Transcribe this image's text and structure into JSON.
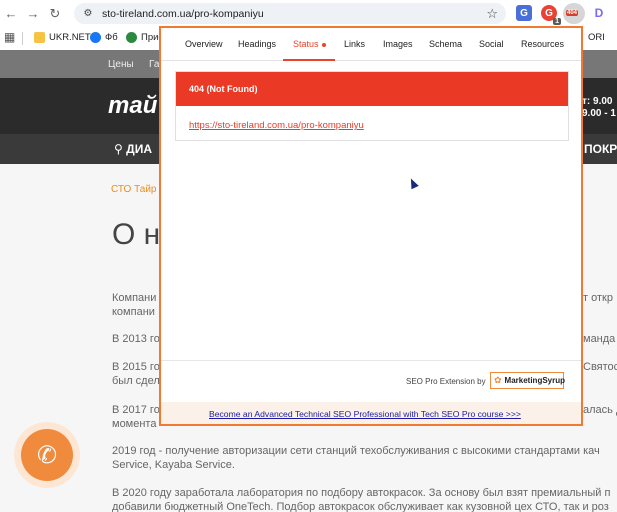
{
  "browser": {
    "url": "sto-tireland.com.ua/pro-kompaniyu",
    "star_icon": "star-icon",
    "extensions": {
      "ext_a_label": "G",
      "ext_b_badge": "1",
      "ext_c_badge": "404",
      "ext_d_label": "D"
    }
  },
  "bookmarks": {
    "items": [
      "UKR.NET",
      "Фб",
      "Прие",
      "ORI"
    ]
  },
  "website": {
    "nav": [
      "Цены",
      "Га"
    ],
    "logo": "тай",
    "hours_line1": "т: 9.00",
    "hours_line2": "9.00 - 1",
    "menu_left": "ДИА",
    "menu_right": "ПОКР",
    "breadcrumb": "СТО Тайр",
    "heading": "О н",
    "paragraphs": [
      "Компани",
      "компани",
      "В 2013 го",
      "В 2015 го",
      "был сдел",
      "В 2017 го",
      "момента",
      "2019 год  - получение авторизации сети станций техобслуживания с высокими стандартами кач",
      "Service, Kayaba Service.",
      "В 2020 году заработала лаборатория по подбору автокрасок. За основу был взят премиальный п",
      "добавили бюджетный OneTech. Подбор автокрасок обслуживает как кузовной цех СТО, так и роз"
    ],
    "right_fragments": [
      "т откр",
      "манда",
      "Святос",
      "алась д"
    ]
  },
  "popup": {
    "tabs": [
      "Overview",
      "Headings",
      "Status",
      "Links",
      "Images",
      "Schema",
      "Social",
      "Resources"
    ],
    "active_tab": "Status",
    "status_code": "404 (Not Found)",
    "status_url": "https://sto-tireland.com.ua/pro-kompaniyu",
    "extension_label": "SEO Pro Extension by",
    "brand": "MarketingSyrup",
    "promo_text": "Become an Advanced Technical SEO Professional with Tech SEO Pro course >>>"
  },
  "colors": {
    "accent": "#f07a30",
    "error": "#ea3a26",
    "link": "#1a1aa6"
  }
}
